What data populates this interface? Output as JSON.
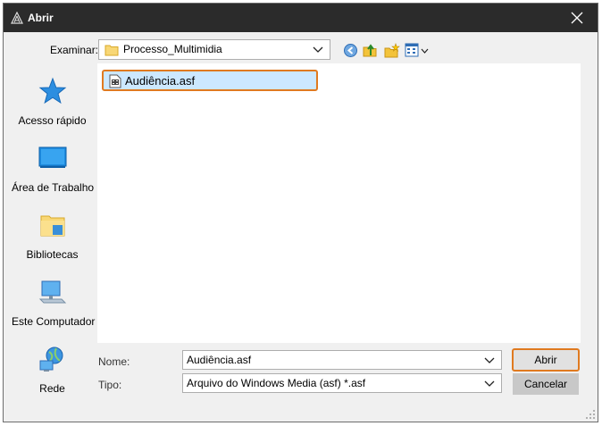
{
  "window": {
    "title": "Abrir",
    "close_glyph": "✕"
  },
  "lookin": {
    "label": "Examinar:",
    "value": "Processo_Multimidia"
  },
  "toolbar": {
    "icons": [
      "back-icon",
      "up-folder-icon",
      "new-folder-icon",
      "view-menu-icon"
    ]
  },
  "places": [
    {
      "label": "Acesso rápido",
      "icon": "star-icon"
    },
    {
      "label": "Área de Trabalho",
      "icon": "desktop-icon"
    },
    {
      "label": "Bibliotecas",
      "icon": "library-folder-icon"
    },
    {
      "label": "Este Computador",
      "icon": "computer-icon"
    },
    {
      "label": "Rede",
      "icon": "network-icon"
    }
  ],
  "files": [
    {
      "name": "Audiência.asf",
      "icon": "media-file-icon",
      "selected": true
    }
  ],
  "filename": {
    "label": "Nome:",
    "value": "Audiência.asf"
  },
  "filetype": {
    "label": "Tipo:",
    "value": "Arquivo do Windows Media (asf) *.asf"
  },
  "buttons": {
    "open": "Abrir",
    "cancel": "Cancelar"
  },
  "colors": {
    "titlebar": "#2b2b2b",
    "highlight": "#e07a20",
    "selection": "#cce8ff",
    "accent": "#0078d7"
  }
}
